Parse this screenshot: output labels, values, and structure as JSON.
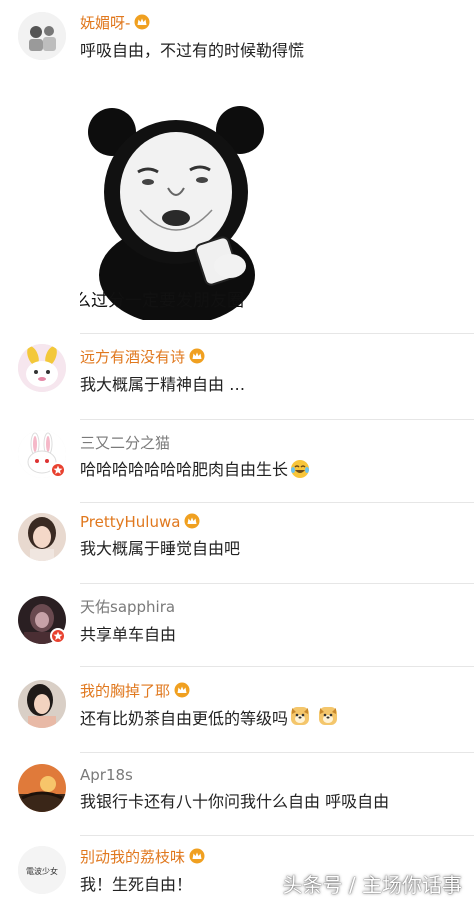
{
  "comments": [
    {
      "username": "妩媚呀-",
      "text": "呼吸自由，不过有的时候勒得慌",
      "vip": true
    },
    {
      "username": "远方有酒没有诗",
      "text": "我大概属于精神自由 …",
      "vip": true
    },
    {
      "username": "三又二分之猫",
      "text": "哈哈哈哈哈哈哈肥肉自由生长",
      "vip": false
    },
    {
      "username": "PrettyHuluwa",
      "text": "我大概属于睡觉自由吧",
      "vip": true
    },
    {
      "username": "天佑sapphira",
      "text": "共享单车自由",
      "vip": false
    },
    {
      "username": "我的胸掉了耶",
      "text": "还有比奶茶自由更低的等级吗",
      "vip": true
    },
    {
      "username": "Apr18s",
      "text": "我银行卡还有八十你问我什么自由 呼吸自由",
      "vip": false
    },
    {
      "username": "别动我的荔枝味",
      "text": "我！生死自由！",
      "vip": true
    }
  ],
  "meme": {
    "caption": "么过分一定要发朋友圈",
    "icon": "panda-meme-image"
  },
  "avatar_text": {
    "comment_8": "電波少女"
  },
  "watermark": "头条号 / 主场你话事",
  "colors": {
    "vip_name": "#e0781e",
    "normal_name": "#7a7a7a",
    "badge": "#e8412f",
    "crown": "#f0a020"
  }
}
